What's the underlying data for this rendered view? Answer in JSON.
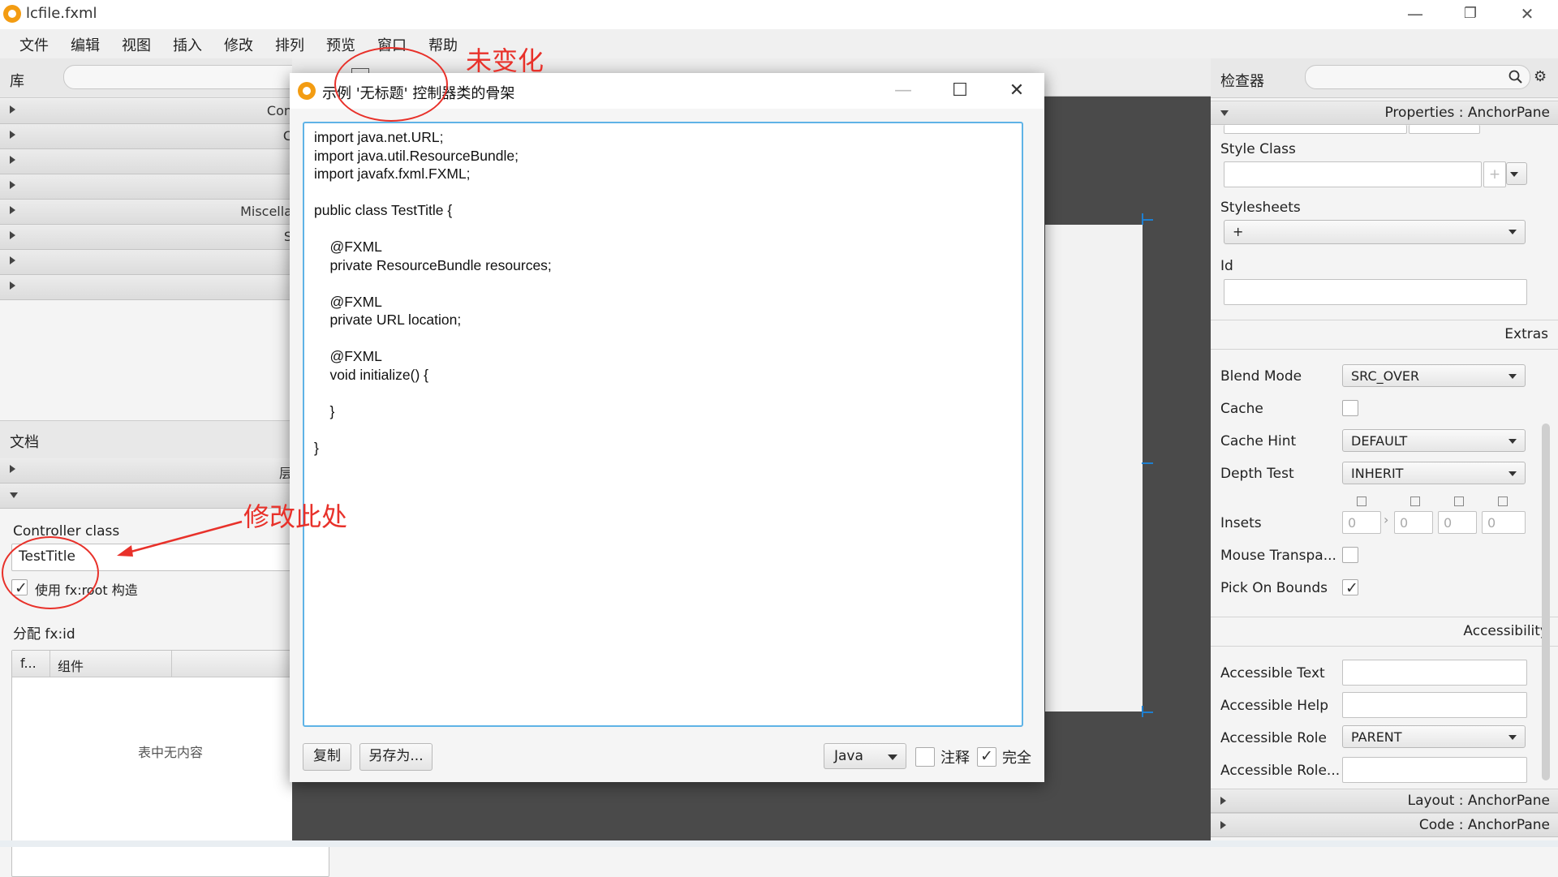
{
  "window": {
    "title": "lcfile.fxml",
    "minimize": "—",
    "restore": "❐",
    "close": "✕"
  },
  "menu": [
    "文件",
    "编辑",
    "视图",
    "插入",
    "修改",
    "排列",
    "预览",
    "窗口",
    "帮助"
  ],
  "library": {
    "title": "库",
    "rows": [
      "Con",
      "C",
      "",
      "",
      "Miscella",
      "S",
      "",
      ""
    ]
  },
  "document": {
    "title": "文档",
    "rows": [
      "层",
      ""
    ],
    "controller_label": "Controller class",
    "controller_value": "TestTitle",
    "fxroot_label": "使用 fx:root 构造",
    "fxid_label": "分配 fx:id",
    "table_headers": [
      "f...",
      "组件"
    ],
    "table_empty": "表中无内容"
  },
  "dialog": {
    "title": "示例 '无标题' 控制器类的骨架",
    "minimize": "—",
    "maximize": "☐",
    "close": "✕",
    "code_lines": [
      "import java.net.URL;",
      "import java.util.ResourceBundle;",
      "import javafx.fxml.FXML;",
      "",
      "public class TestTitle {",
      "",
      "    @FXML",
      "    private ResourceBundle resources;",
      "",
      "    @FXML",
      "    private URL location;",
      "",
      "    @FXML",
      "    void initialize() {",
      "",
      "    }",
      "",
      "}"
    ],
    "copy_button": "复制",
    "saveas_button": "另存为...",
    "language": "Java",
    "comments_label": "注释",
    "complete_label": "完全"
  },
  "inspector": {
    "title": "检查器",
    "properties_bar": "Properties : AnchorPane",
    "style_class_label": "Style Class",
    "stylesheets_label": "Stylesheets",
    "stylesheets_add": "+",
    "id_label": "Id",
    "extras_label": "Extras",
    "blend_mode_label": "Blend Mode",
    "blend_mode_value": "SRC_OVER",
    "cache_label": "Cache",
    "cache_hint_label": "Cache Hint",
    "cache_hint_value": "DEFAULT",
    "depth_test_label": "Depth Test",
    "depth_test_value": "INHERIT",
    "insets_label": "Insets",
    "insets_values": [
      "0",
      "0",
      "0",
      "0"
    ],
    "mouse_transparent_label": "Mouse Transpa...",
    "pick_on_bounds_label": "Pick On Bounds",
    "accessibility_label": "Accessibility",
    "accessible_text_label": "Accessible Text",
    "accessible_help_label": "Accessible Help",
    "accessible_role_label": "Accessible Role",
    "accessible_role_value": "PARENT",
    "accessible_role_desc_label": "Accessible Role...",
    "layout_bar": "Layout : AnchorPane",
    "code_bar": "Code : AnchorPane"
  },
  "annotations": {
    "unchanged": "未变化",
    "modify_here": "修改此处"
  },
  "colors": {
    "accent_blue": "#5fb3e6",
    "annotation_red": "#e8312a",
    "app_orange": "#f39c12"
  }
}
